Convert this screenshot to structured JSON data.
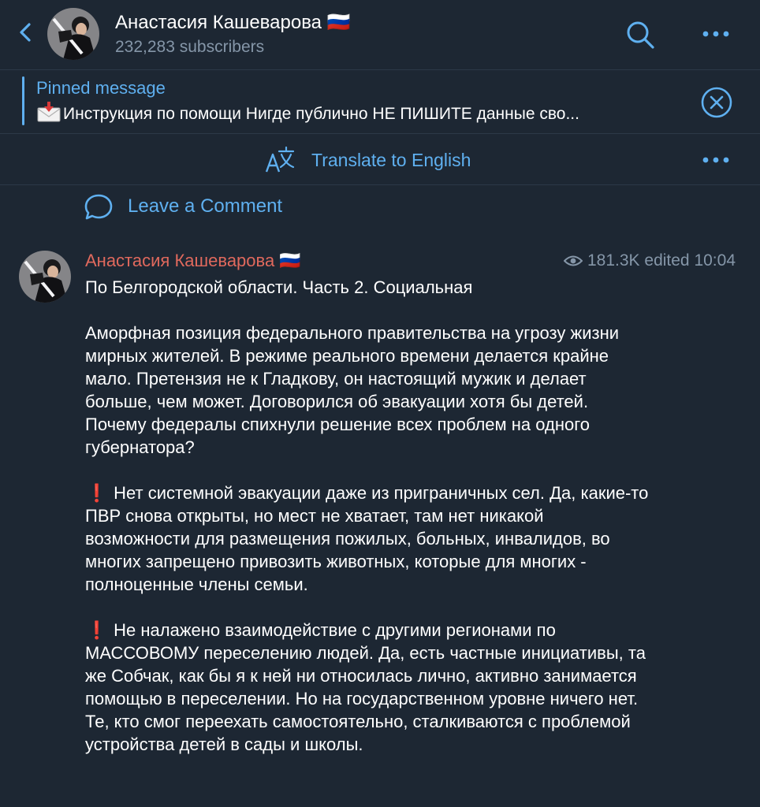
{
  "header": {
    "channel_name": "Анастасия Кашеварова 🇷🇺",
    "subscribers": "232,283 subscribers"
  },
  "pinned": {
    "title": "Pinned message",
    "text": "Инструкция по помощи  Нигде публично НЕ ПИШИТЕ данные сво..."
  },
  "translate": {
    "label": "Translate to English"
  },
  "comment": {
    "label": "Leave a Comment"
  },
  "post": {
    "author": "Анастасия Кашеварова 🇷🇺",
    "views": "181.3K",
    "edited": "edited 10:04",
    "paragraphs": [
      "По Белгородской области. Часть 2. Социальная",
      "Аморфная позиция федерального правительства на угрозу жизни мирных жителей. В режиме реального времени делается крайне мало. Претензия не к Гладкову, он настоящий мужик и делает больше, чем может. Договорился об эвакуации хотя бы детей. Почему федералы спихнули решение всех проблем на одного губернатора?",
      "Нет системной эвакуации даже из приграничных сел. Да, какие-то ПВР снова открыты, но мест не хватает, там нет никакой возможности для размещения пожилых, больных, инвалидов, во многих запрещено привозить животных, которые для многих - полноценные члены семьи.",
      "Не налажено взаимодействие с другими регионами по МАССОВОМУ переселению людей. Да, есть частные инициативы, та же Собчак, как бы я к ней ни относилась лично, активно занимается помощью в переселении. Но на государственном уровне ничего нет.\nТе, кто смог переехать самостоятельно, сталкиваются с проблемой устройства детей в сады и школы."
    ],
    "bullet_mark": "❗"
  },
  "colors": {
    "background": "#1d2733",
    "accent": "#5fb0f0",
    "author": "#e0695d",
    "muted": "#8596a8"
  }
}
